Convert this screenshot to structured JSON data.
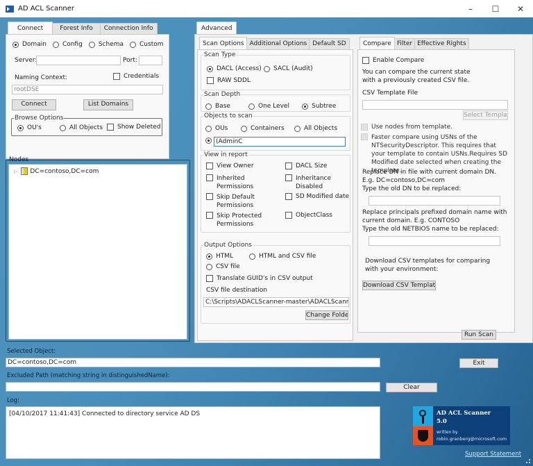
{
  "window": {
    "title": "AD ACL Scanner",
    "controls": {
      "minimize": "–",
      "maximize": "☐",
      "close": "✕"
    }
  },
  "connect_panel": {
    "tabs": [
      "Connect",
      "Forest Info",
      "Connection Info"
    ],
    "active_tab": "Connect",
    "partition_options": [
      {
        "label": "Domain",
        "selected": true
      },
      {
        "label": "Config",
        "selected": false
      },
      {
        "label": "Schema",
        "selected": false
      },
      {
        "label": "Custom",
        "selected": false
      }
    ],
    "server_label": "Server:",
    "server_value": "",
    "port_label": "Port:",
    "port_value": "",
    "naming_context_label": "Naming Context:",
    "credentials_label": "Credentials",
    "credentials_checked": false,
    "naming_context_value": "rootDSE",
    "connect_button": "Connect",
    "list_domains_button": "List Domains",
    "browse_options": {
      "title": "Browse Options",
      "ous_label": "OU's",
      "ous_selected": true,
      "all_objects_label": "All Objects",
      "all_objects_selected": false,
      "show_deleted_label": "Show Deleted",
      "show_deleted_checked": false
    }
  },
  "nodes": {
    "title": "Nodes",
    "items": [
      {
        "label": "DC=contoso,DC=com",
        "icon": "domain-folder-icon",
        "expander": "▷"
      }
    ]
  },
  "advanced": {
    "tab_label": "Advanced",
    "scan_tabs": [
      "Scan Options",
      "Additional Options",
      "Default SD"
    ],
    "active_scan_tab": "Scan Options",
    "scan_type": {
      "title": "Scan Type",
      "dacl_label": "DACL (Access)",
      "dacl_selected": true,
      "sacl_label": "SACL (Audit)",
      "sacl_selected": false,
      "raw_sddl_label": "RAW SDDL",
      "raw_sddl_checked": false
    },
    "scan_depth": {
      "title": "Scan Depth",
      "options": [
        {
          "label": "Base",
          "selected": false
        },
        {
          "label": "One Level",
          "selected": false
        },
        {
          "label": "Subtree",
          "selected": true
        }
      ]
    },
    "objects_to_scan": {
      "title": "Objects to scan",
      "options": [
        {
          "label": "OUs",
          "selected": false
        },
        {
          "label": "Containers",
          "selected": false
        },
        {
          "label": "All Objects",
          "selected": false
        }
      ],
      "custom_selected": true,
      "custom_filter_value": "(AdminC"
    },
    "view_in_report": {
      "title": "View in report",
      "left": [
        {
          "label": "View Owner",
          "checked": false
        },
        {
          "label": "Inherited Permissions",
          "checked": false
        },
        {
          "label": "Skip Default Permissions",
          "checked": false
        },
        {
          "label": "Skip Protected Permissions",
          "checked": false
        }
      ],
      "right": [
        {
          "label": "DACL Size",
          "checked": false
        },
        {
          "label": "Inheritance Disabled",
          "checked": false
        },
        {
          "label": "SD Modified date",
          "checked": false
        },
        {
          "label": "ObjectClass",
          "checked": false
        }
      ]
    },
    "output_options": {
      "title": "Output Options",
      "html_label": "HTML",
      "html_selected": true,
      "html_csv_label": "HTML and CSV file",
      "html_csv_selected": false,
      "csv_label": "CSV file",
      "csv_selected": false,
      "translate_guid_label": "Translate GUID's in CSV output",
      "translate_guid_checked": false,
      "csv_dest_label": "CSV file destination",
      "csv_dest_value": "C:\\Scripts\\ADACLScanner-master\\ADACLScanner-m",
      "change_folder_button": "Change Folder"
    }
  },
  "compare": {
    "tabs": [
      "Compare",
      "Filter",
      "Effective Rights"
    ],
    "active_tab": "Compare",
    "enable_compare_label": "Enable Compare",
    "enable_compare_checked": false,
    "description": "You can compare the current state with a previously created CSV file.",
    "csv_template_label": "CSV Template File",
    "csv_template_value": "",
    "select_template_button": "Select Template",
    "use_nodes_label": "Use nodes from template.",
    "faster_compare_label": "Faster compare using USNs of the NTSecurityDescriptor. This requires that your template to contain USNs.Requires SD Modified date selected when creating the template.",
    "replace_dn_text": "Replace DN in file with current domain DN.\nE.g. DC=contoso,DC=com\nType the old DN to be replaced:",
    "replace_dn_value": "",
    "replace_netbios_text": "Replace principals prefixed domain name with current domain. E.g. CONTOSO\nType the old NETBIOS name to be replaced:",
    "replace_netbios_value": "",
    "download_text": "Download CSV templates for comparing with your environment:",
    "download_button": "Download CSV Templates"
  },
  "run_scan_button": "Run Scan",
  "bottom": {
    "selected_object_label": "Selected Object:",
    "selected_object_value": "DC=contoso,DC=com",
    "excluded_path_label": "Excluded Path (matching string in distinguishedName):",
    "excluded_path_value": "",
    "exit_button": "Exit",
    "clear_button": "Clear",
    "log_label": "Log:",
    "log_entries": [
      "[04/10/2017 11:41:43] Connected to directory service  AD DS"
    ]
  },
  "about": {
    "product_name": "AD ACL Scanner",
    "version": "5.0",
    "written_by": "written by",
    "author_email": "robin.granberg@microsoft.com",
    "support_link": "Support Statement",
    "colors": {
      "magnifier_bg": "#1ea7e1",
      "shield_bg": "#e8521f",
      "panel_bg": "#0d3f78"
    }
  }
}
